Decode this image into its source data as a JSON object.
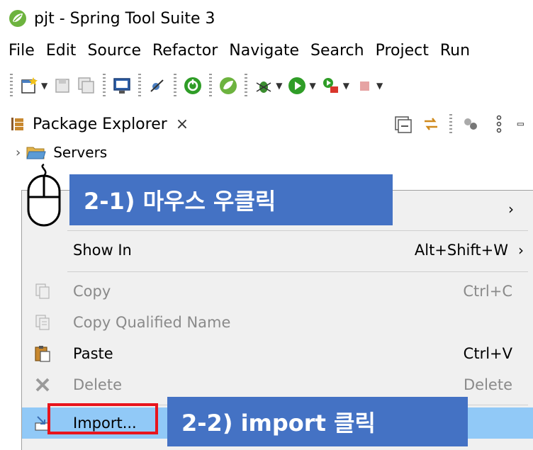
{
  "window": {
    "title": "pjt - Spring Tool Suite 3"
  },
  "menubar": [
    "File",
    "Edit",
    "Source",
    "Refactor",
    "Navigate",
    "Search",
    "Project",
    "Run"
  ],
  "package_explorer": {
    "tab_label": "Package Explorer",
    "close_glyph": "×",
    "tree": [
      {
        "label": "Servers",
        "expanded": false
      }
    ]
  },
  "context_menu": {
    "items": [
      {
        "label": "",
        "shortcut": "",
        "submenu": true
      },
      {
        "label": "Show In",
        "shortcut": "Alt+Shift+W",
        "submenu": true
      },
      {
        "label": "Copy",
        "shortcut": "Ctrl+C",
        "enabled": false
      },
      {
        "label": "Copy Qualified Name",
        "shortcut": "",
        "enabled": false
      },
      {
        "label": "Paste",
        "shortcut": "Ctrl+V",
        "enabled": true
      },
      {
        "label": "Delete",
        "shortcut": "Delete",
        "enabled": false
      },
      {
        "label": "Import...",
        "shortcut": "",
        "highlighted": true
      }
    ],
    "submenu_glyph": "›"
  },
  "annotations": {
    "step1": "2-1) 마우스 우클릭",
    "step2": "2-2) import 클릭"
  },
  "colors": {
    "callout_bg": "#4472c4",
    "highlight": "#91c9f7",
    "import_box": "#e8141c",
    "spring_green": "#6db33f"
  }
}
